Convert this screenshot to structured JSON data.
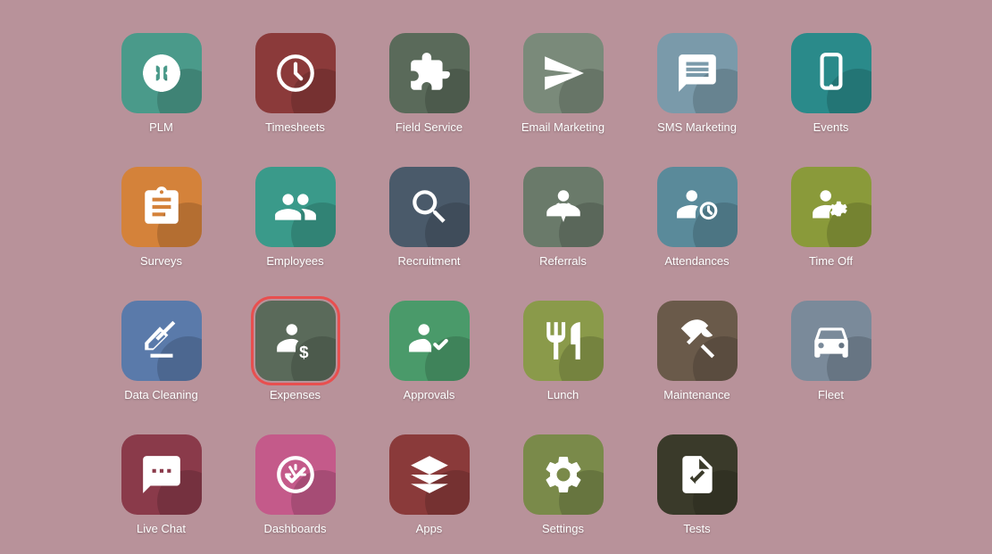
{
  "apps": [
    {
      "id": "plm",
      "label": "PLM",
      "color": "color-teal",
      "icon": "box-arrows"
    },
    {
      "id": "timesheets",
      "label": "Timesheets",
      "color": "color-dark-red",
      "icon": "clock"
    },
    {
      "id": "field-service",
      "label": "Field Service",
      "color": "color-dark-gray",
      "icon": "puzzle"
    },
    {
      "id": "email-marketing",
      "label": "Email Marketing",
      "color": "color-medium-gray",
      "icon": "paper-plane"
    },
    {
      "id": "sms-marketing",
      "label": "SMS Marketing",
      "color": "color-blue-gray",
      "icon": "sms"
    },
    {
      "id": "events",
      "label": "Events",
      "color": "color-teal-dark",
      "icon": "phone-rotate"
    },
    {
      "id": "surveys",
      "label": "Surveys",
      "color": "color-orange",
      "icon": "clipboard"
    },
    {
      "id": "employees",
      "label": "Employees",
      "color": "color-teal2",
      "icon": "people"
    },
    {
      "id": "recruitment",
      "label": "Recruitment",
      "color": "color-dark-slate",
      "icon": "magnifier"
    },
    {
      "id": "referrals",
      "label": "Referrals",
      "color": "color-slate",
      "icon": "person-robe"
    },
    {
      "id": "attendances",
      "label": "Attendances",
      "color": "color-teal3",
      "icon": "person-clock"
    },
    {
      "id": "time-off",
      "label": "Time Off",
      "color": "color-olive",
      "icon": "person-gear"
    },
    {
      "id": "data-cleaning",
      "label": "Data Cleaning",
      "color": "color-blue",
      "icon": "broom"
    },
    {
      "id": "expenses",
      "label": "Expenses",
      "color": "color-dark-gunmetal",
      "icon": "person-dollar",
      "selected": true
    },
    {
      "id": "approvals",
      "label": "Approvals",
      "color": "color-green",
      "icon": "person-check"
    },
    {
      "id": "lunch",
      "label": "Lunch",
      "color": "color-yellow-green",
      "icon": "fork-knife"
    },
    {
      "id": "maintenance",
      "label": "Maintenance",
      "color": "color-dark-brown",
      "icon": "hammer"
    },
    {
      "id": "fleet",
      "label": "Fleet",
      "color": "color-steel",
      "icon": "car"
    },
    {
      "id": "live-chat",
      "label": "Live Chat",
      "color": "color-wine",
      "icon": "chat"
    },
    {
      "id": "dashboards",
      "label": "Dashboards",
      "color": "color-pink",
      "icon": "gauge"
    },
    {
      "id": "apps",
      "label": "Apps",
      "color": "color-maroon",
      "icon": "cubes"
    },
    {
      "id": "settings",
      "label": "Settings",
      "color": "color-dark-olive",
      "icon": "gear"
    },
    {
      "id": "tests",
      "label": "Tests",
      "color": "color-dark-brown2",
      "icon": "doc-check"
    }
  ]
}
